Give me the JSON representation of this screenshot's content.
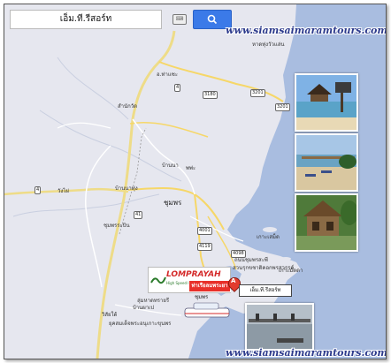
{
  "search": {
    "value": "เอ็ม.ที.รีสอร์ท"
  },
  "site": {
    "url": "www.siamsaimaramtours.com"
  },
  "map_labels": {
    "town1": "อ.ท่าแซะ",
    "town2": "บ้านนา",
    "town3": "ชุมพร",
    "town4": "วังไผ่",
    "town5": "บ้านนาทุ่ง",
    "town6": "ชุมพรระบิน",
    "town7": "วิสัยใต้",
    "town8": "สำนักวัด",
    "place1": "พพ่ะ",
    "place2": "หาดทุ่งวัวแล่น",
    "place3": "เกาะเสม็ด",
    "place4": "สวนรุกขชาติคอกพรสวรรค์",
    "place5": "เกาะมัดดา",
    "place6": "ถนนชุมพรสะพี",
    "place7": "ลุ่มหาดทรายรี",
    "place8": "บ้านผาเป",
    "place9": "ยุคสมเด็จพระอนุเกาะขุนพร",
    "road1": "3180",
    "road2": "3201",
    "road3": "4",
    "road4": "41",
    "road5": "4001",
    "road6": "4119",
    "road7": "4098",
    "road8": "3201",
    "road9": "4"
  },
  "logo": {
    "brand": "LOMPRAYAH",
    "tagline": "High Speed Ferries"
  },
  "pier": {
    "label": "ท่าเรือลมพระยา",
    "sub": "ชุมพร"
  },
  "marker": {
    "letter": "A",
    "name": "เอ็ม.ที.รีสอร์ท"
  },
  "colors": {
    "water": "#a9bde0",
    "land": "#e4e6ef",
    "road": "#f6d768",
    "highway": "#eedc88",
    "pin": "#e23b2e"
  }
}
